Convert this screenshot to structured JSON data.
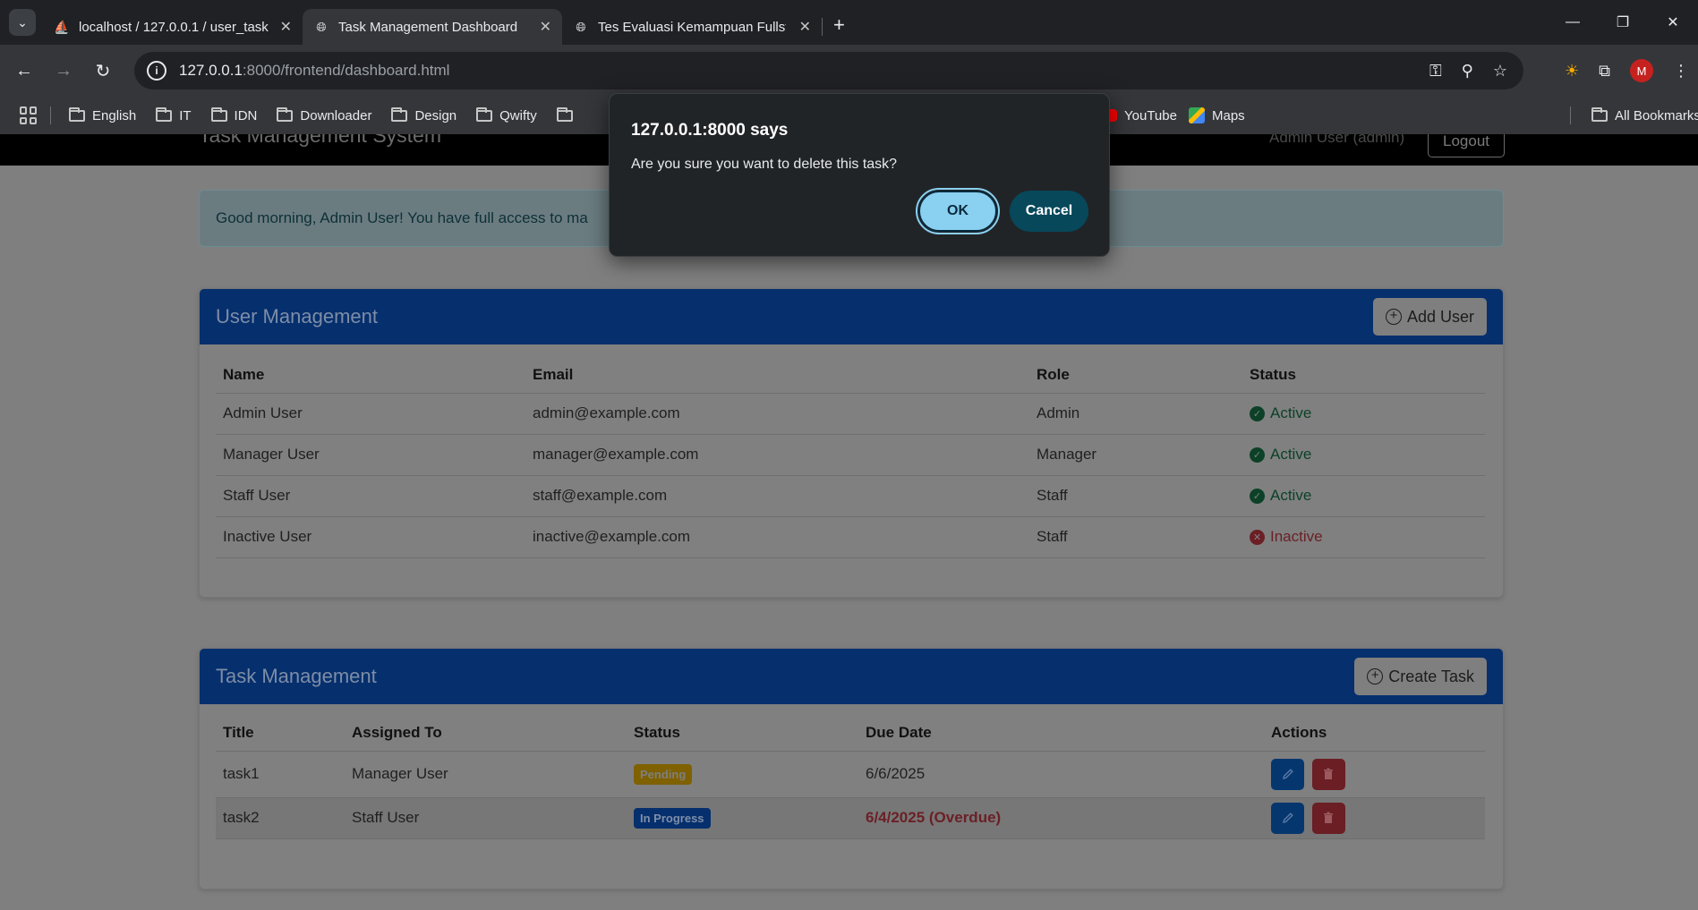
{
  "browser": {
    "tabs": [
      {
        "title": "localhost / 127.0.0.1 / user_task",
        "active": false
      },
      {
        "title": "Task Management Dashboard",
        "active": true
      },
      {
        "title": "Tes Evaluasi Kemampuan Fullsta",
        "active": false
      }
    ],
    "url_host": "127.0.0.1",
    "url_path": ":8000/frontend/dashboard.html",
    "profile_initial": "M",
    "bookmarks": [
      "English",
      "IT",
      "IDN",
      "Downloader",
      "Design",
      "Qwifty"
    ],
    "bookmarks_right": [
      "YouTube",
      "Maps"
    ],
    "all_bookmarks": "All Bookmarks"
  },
  "app": {
    "brand": "Task Management System",
    "user_label": "Admin User (admin)",
    "logout_label": "Logout",
    "greeting": "Good morning, Admin User! You have full access to ma"
  },
  "user_management": {
    "title": "User Management",
    "add_label": "Add User",
    "columns": [
      "Name",
      "Email",
      "Role",
      "Status"
    ],
    "rows": [
      {
        "name": "Admin User",
        "email": "admin@example.com",
        "role": "Admin",
        "status": "Active"
      },
      {
        "name": "Manager User",
        "email": "manager@example.com",
        "role": "Manager",
        "status": "Active"
      },
      {
        "name": "Staff User",
        "email": "staff@example.com",
        "role": "Staff",
        "status": "Active"
      },
      {
        "name": "Inactive User",
        "email": "inactive@example.com",
        "role": "Staff",
        "status": "Inactive"
      }
    ]
  },
  "task_management": {
    "title": "Task Management",
    "create_label": "Create Task",
    "columns": [
      "Title",
      "Assigned To",
      "Status",
      "Due Date",
      "Actions"
    ],
    "rows": [
      {
        "title": "task1",
        "assigned": "Manager User",
        "status": "Pending",
        "due": "6/6/2025"
      },
      {
        "title": "task2",
        "assigned": "Staff User",
        "status": "In Progress",
        "due": "6/4/2025 (Overdue)"
      }
    ]
  },
  "dialog": {
    "title": "127.0.0.1:8000 says",
    "message": "Are you sure you want to delete this task?",
    "ok_label": "OK",
    "cancel_label": "Cancel"
  }
}
